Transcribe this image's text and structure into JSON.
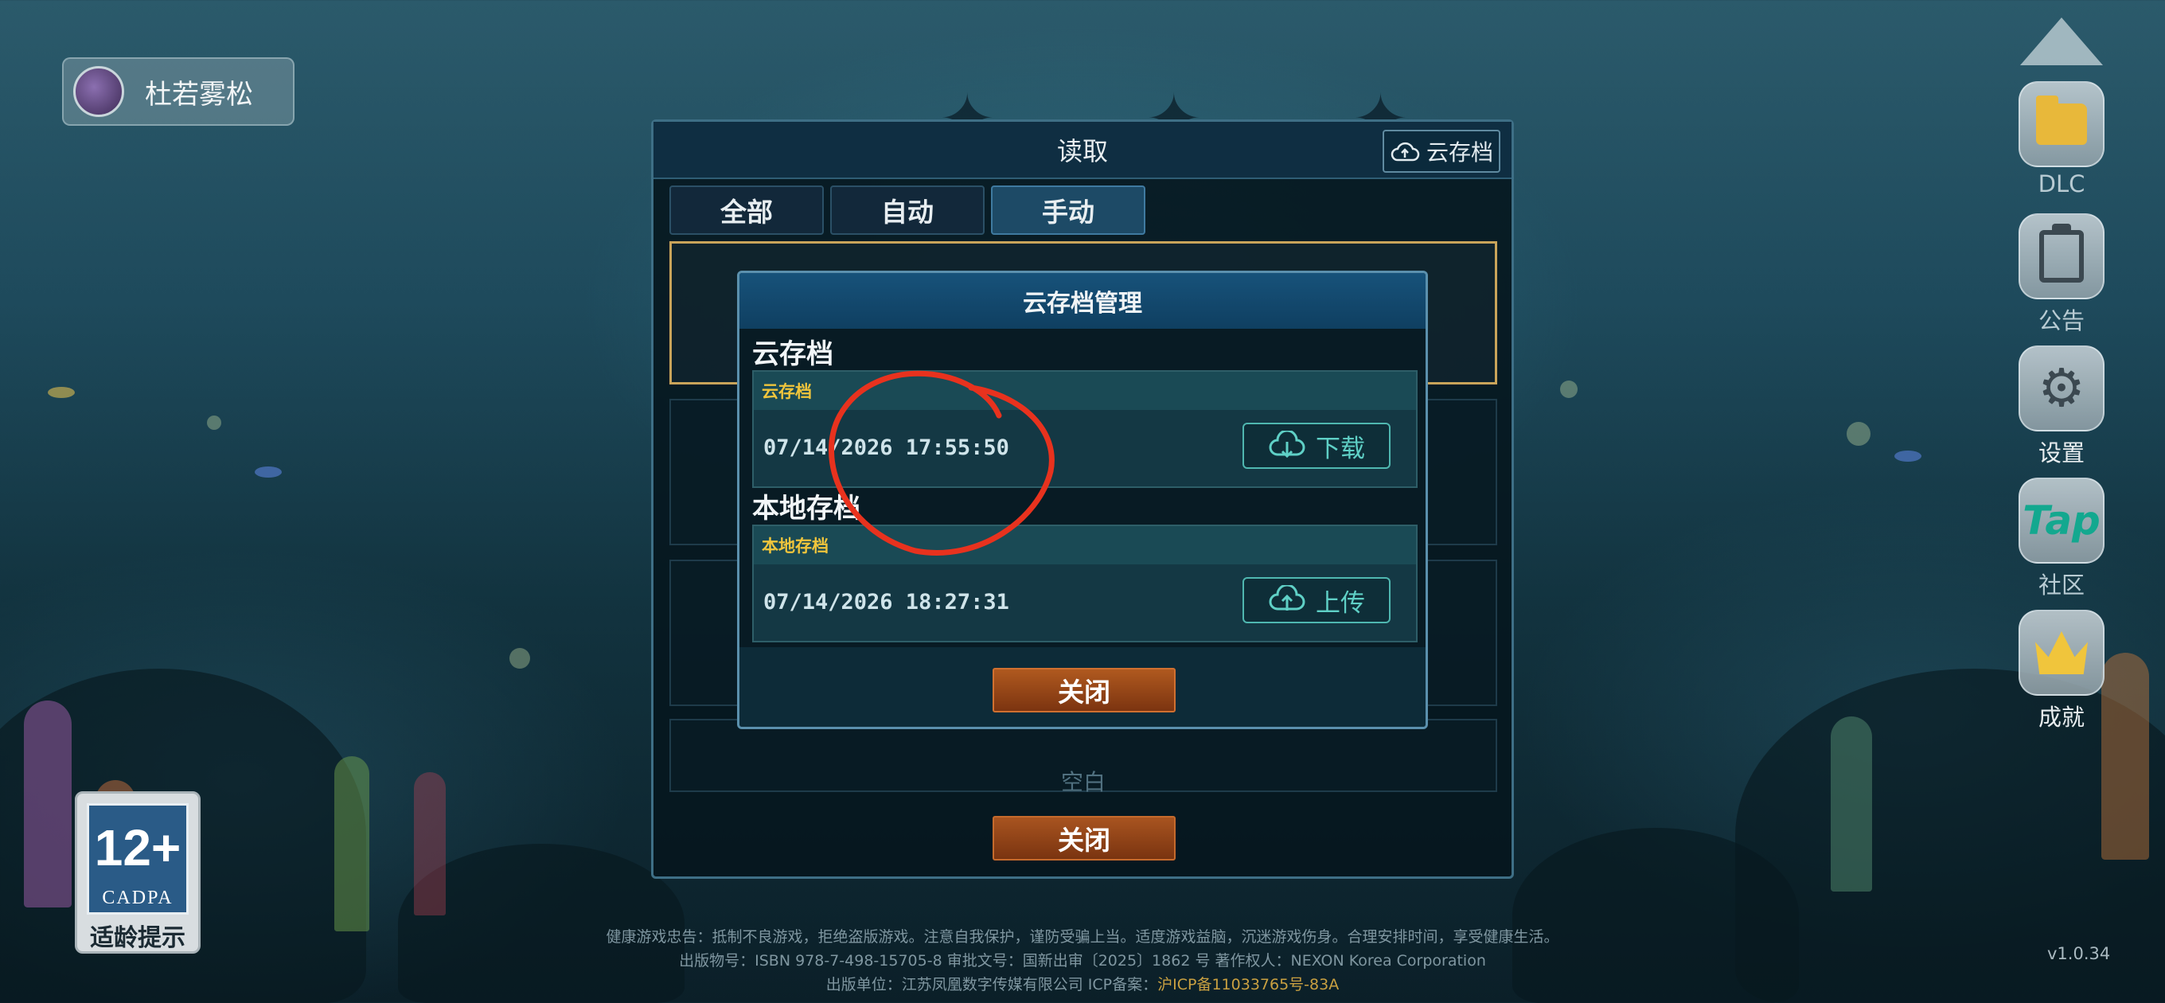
{
  "profile": {
    "name": "杜若雾松"
  },
  "side_menu": {
    "dlc": "DLC",
    "notice": "公告",
    "settings": "设置",
    "community": "社区",
    "achievements": "成就"
  },
  "age_rating": {
    "number": "12+",
    "org": "CADPA",
    "tip": "适龄提示"
  },
  "load_window": {
    "title": "读取",
    "cloud_button": "云存档",
    "tabs": [
      {
        "label": "全部",
        "active": false
      },
      {
        "label": "自动",
        "active": false
      },
      {
        "label": "手动",
        "active": true
      }
    ],
    "slot_peek": "空白",
    "close_label": "关闭"
  },
  "cloud_dialog": {
    "title": "云存档管理",
    "cloud_section": {
      "title": "云存档",
      "card_label": "云存档",
      "timestamp": "07/14/2026 17:55:50",
      "button_label": "下载"
    },
    "local_section": {
      "title": "本地存档",
      "card_label": "本地存档",
      "timestamp": "07/14/2026 18:27:31",
      "button_label": "上传"
    },
    "close_label": "关闭"
  },
  "footer": {
    "line1": "健康游戏忠告：抵制不良游戏，拒绝盗版游戏。注意自我保护，谨防受骗上当。适度游戏益脑，沉迷游戏伤身。合理安排时间，享受健康生活。",
    "line2": "出版物号：ISBN 978-7-498-15705-8    审批文号：国新出审〔2025〕1862 号    著作权人：NEXON Korea Corporation",
    "line3_prefix": "出版单位：江苏凤凰数字传媒有限公司    ICP备案：",
    "line3_icp": "沪ICP备11033765号-83A"
  },
  "version": "v1.0.34",
  "colors": {
    "accent_teal": "#5fd0c6",
    "label_yellow": "#f0c53c",
    "close_orange": "#a85420",
    "annotation_red": "#e8321e"
  }
}
